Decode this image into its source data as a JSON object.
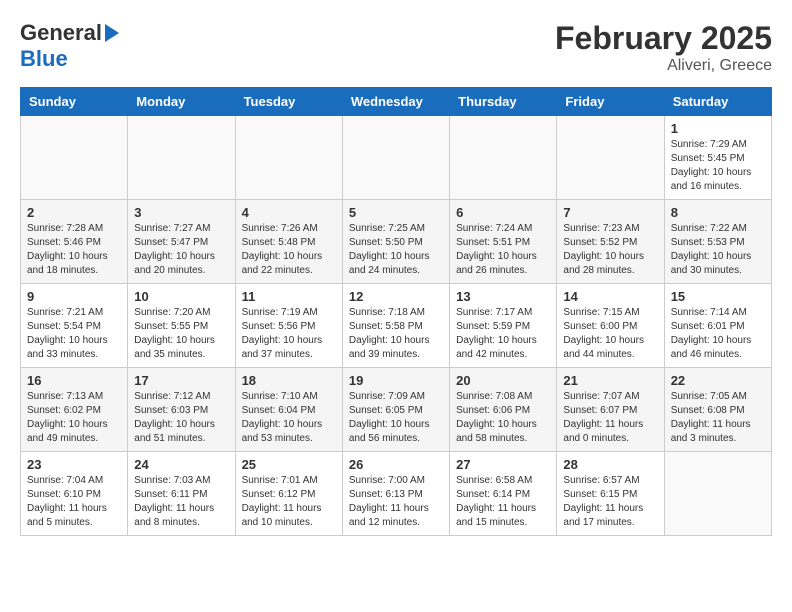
{
  "header": {
    "logo_line1": "General",
    "logo_line2": "Blue",
    "month_title": "February 2025",
    "location": "Aliveri, Greece"
  },
  "days_of_week": [
    "Sunday",
    "Monday",
    "Tuesday",
    "Wednesday",
    "Thursday",
    "Friday",
    "Saturday"
  ],
  "weeks": [
    [
      {
        "day": "",
        "info": ""
      },
      {
        "day": "",
        "info": ""
      },
      {
        "day": "",
        "info": ""
      },
      {
        "day": "",
        "info": ""
      },
      {
        "day": "",
        "info": ""
      },
      {
        "day": "",
        "info": ""
      },
      {
        "day": "1",
        "info": "Sunrise: 7:29 AM\nSunset: 5:45 PM\nDaylight: 10 hours\nand 16 minutes."
      }
    ],
    [
      {
        "day": "2",
        "info": "Sunrise: 7:28 AM\nSunset: 5:46 PM\nDaylight: 10 hours\nand 18 minutes."
      },
      {
        "day": "3",
        "info": "Sunrise: 7:27 AM\nSunset: 5:47 PM\nDaylight: 10 hours\nand 20 minutes."
      },
      {
        "day": "4",
        "info": "Sunrise: 7:26 AM\nSunset: 5:48 PM\nDaylight: 10 hours\nand 22 minutes."
      },
      {
        "day": "5",
        "info": "Sunrise: 7:25 AM\nSunset: 5:50 PM\nDaylight: 10 hours\nand 24 minutes."
      },
      {
        "day": "6",
        "info": "Sunrise: 7:24 AM\nSunset: 5:51 PM\nDaylight: 10 hours\nand 26 minutes."
      },
      {
        "day": "7",
        "info": "Sunrise: 7:23 AM\nSunset: 5:52 PM\nDaylight: 10 hours\nand 28 minutes."
      },
      {
        "day": "8",
        "info": "Sunrise: 7:22 AM\nSunset: 5:53 PM\nDaylight: 10 hours\nand 30 minutes."
      }
    ],
    [
      {
        "day": "9",
        "info": "Sunrise: 7:21 AM\nSunset: 5:54 PM\nDaylight: 10 hours\nand 33 minutes."
      },
      {
        "day": "10",
        "info": "Sunrise: 7:20 AM\nSunset: 5:55 PM\nDaylight: 10 hours\nand 35 minutes."
      },
      {
        "day": "11",
        "info": "Sunrise: 7:19 AM\nSunset: 5:56 PM\nDaylight: 10 hours\nand 37 minutes."
      },
      {
        "day": "12",
        "info": "Sunrise: 7:18 AM\nSunset: 5:58 PM\nDaylight: 10 hours\nand 39 minutes."
      },
      {
        "day": "13",
        "info": "Sunrise: 7:17 AM\nSunset: 5:59 PM\nDaylight: 10 hours\nand 42 minutes."
      },
      {
        "day": "14",
        "info": "Sunrise: 7:15 AM\nSunset: 6:00 PM\nDaylight: 10 hours\nand 44 minutes."
      },
      {
        "day": "15",
        "info": "Sunrise: 7:14 AM\nSunset: 6:01 PM\nDaylight: 10 hours\nand 46 minutes."
      }
    ],
    [
      {
        "day": "16",
        "info": "Sunrise: 7:13 AM\nSunset: 6:02 PM\nDaylight: 10 hours\nand 49 minutes."
      },
      {
        "day": "17",
        "info": "Sunrise: 7:12 AM\nSunset: 6:03 PM\nDaylight: 10 hours\nand 51 minutes."
      },
      {
        "day": "18",
        "info": "Sunrise: 7:10 AM\nSunset: 6:04 PM\nDaylight: 10 hours\nand 53 minutes."
      },
      {
        "day": "19",
        "info": "Sunrise: 7:09 AM\nSunset: 6:05 PM\nDaylight: 10 hours\nand 56 minutes."
      },
      {
        "day": "20",
        "info": "Sunrise: 7:08 AM\nSunset: 6:06 PM\nDaylight: 10 hours\nand 58 minutes."
      },
      {
        "day": "21",
        "info": "Sunrise: 7:07 AM\nSunset: 6:07 PM\nDaylight: 11 hours\nand 0 minutes."
      },
      {
        "day": "22",
        "info": "Sunrise: 7:05 AM\nSunset: 6:08 PM\nDaylight: 11 hours\nand 3 minutes."
      }
    ],
    [
      {
        "day": "23",
        "info": "Sunrise: 7:04 AM\nSunset: 6:10 PM\nDaylight: 11 hours\nand 5 minutes."
      },
      {
        "day": "24",
        "info": "Sunrise: 7:03 AM\nSunset: 6:11 PM\nDaylight: 11 hours\nand 8 minutes."
      },
      {
        "day": "25",
        "info": "Sunrise: 7:01 AM\nSunset: 6:12 PM\nDaylight: 11 hours\nand 10 minutes."
      },
      {
        "day": "26",
        "info": "Sunrise: 7:00 AM\nSunset: 6:13 PM\nDaylight: 11 hours\nand 12 minutes."
      },
      {
        "day": "27",
        "info": "Sunrise: 6:58 AM\nSunset: 6:14 PM\nDaylight: 11 hours\nand 15 minutes."
      },
      {
        "day": "28",
        "info": "Sunrise: 6:57 AM\nSunset: 6:15 PM\nDaylight: 11 hours\nand 17 minutes."
      },
      {
        "day": "",
        "info": ""
      }
    ]
  ]
}
